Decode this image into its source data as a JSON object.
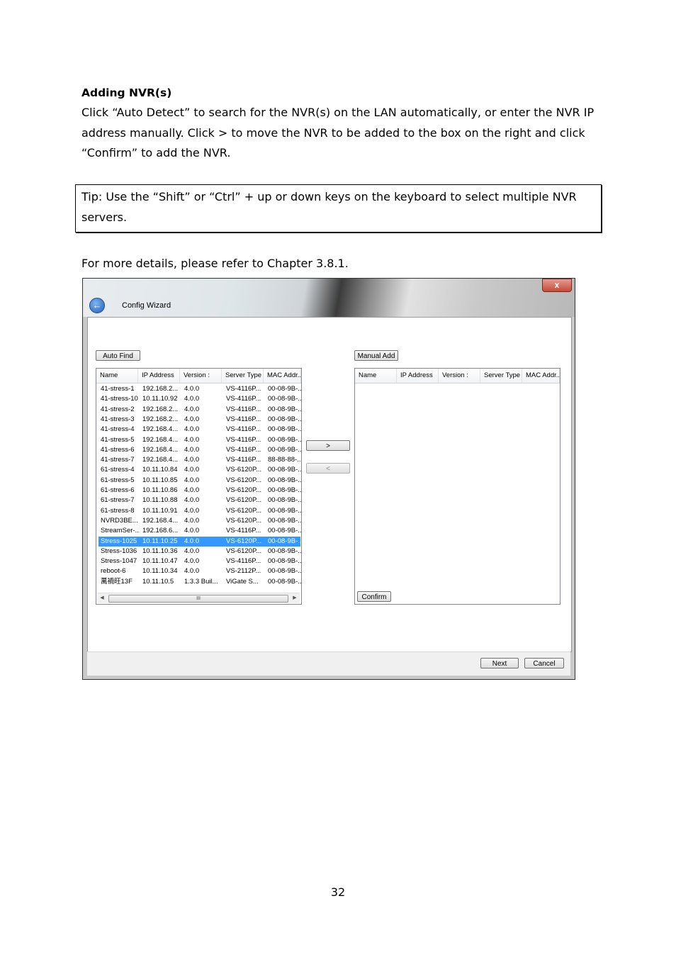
{
  "doc": {
    "heading": "Adding NVR(s)",
    "paragraph1": "Click “Auto Detect” to search for the NVR(s) on the LAN automatically, or enter the NVR IP address manually. Click > to move the NVR to be added to the box on the right and click “Confirm” to add the NVR.",
    "tip": "Tip: Use the “Shift” or “Ctrl” + up or down keys on the keyboard to select multiple NVR servers.",
    "paragraph2": "For more details, please refer to Chapter 3.8.1.",
    "page_number": "32"
  },
  "window": {
    "title": "Config Wizard",
    "close_label": "x",
    "back_icon": "back-arrow-icon",
    "auto_find_label": "Auto Find",
    "manual_add_label": "Manual Add",
    "move_right_label": ">",
    "move_left_label": "<",
    "confirm_label": "Confirm",
    "next_label": "Next",
    "cancel_label": "Cancel",
    "columns": [
      "Name",
      "IP Address",
      "Version :",
      "Server Type",
      "MAC Addr.."
    ],
    "rows": [
      [
        "41-stress-1",
        "192.168.2...",
        "4.0.0",
        "VS-4116P...",
        "00-08-9B-..."
      ],
      [
        "41-stress-10",
        "10.11.10.92",
        "4.0.0",
        "VS-4116P...",
        "00-08-9B-..."
      ],
      [
        "41-stress-2",
        "192.168.2...",
        "4.0.0",
        "VS-4116P...",
        "00-08-9B-..."
      ],
      [
        "41-stress-3",
        "192.168.2...",
        "4.0.0",
        "VS-4116P...",
        "00-08-9B-..."
      ],
      [
        "41-stress-4",
        "192.168.4...",
        "4.0.0",
        "VS-4116P...",
        "00-08-9B-..."
      ],
      [
        "41-stress-5",
        "192.168.4...",
        "4.0.0",
        "VS-4116P...",
        "00-08-9B-..."
      ],
      [
        "41-stress-6",
        "192.168.4...",
        "4.0.0",
        "VS-4116P...",
        "00-08-9B-..."
      ],
      [
        "41-stress-7",
        "192.168.4...",
        "4.0.0",
        "VS-4116P...",
        "88-88-88-..."
      ],
      [
        "61-stress-4",
        "10.11.10.84",
        "4.0.0",
        "VS-6120P...",
        "00-08-9B-..."
      ],
      [
        "61-stress-5",
        "10.11.10.85",
        "4.0.0",
        "VS-6120P...",
        "00-08-9B-..."
      ],
      [
        "61-stress-6",
        "10.11.10.86",
        "4.0.0",
        "VS-6120P...",
        "00-08-9B-..."
      ],
      [
        "61-stress-7",
        "10.11.10.88",
        "4.0.0",
        "VS-6120P...",
        "00-08-9B-..."
      ],
      [
        "61-stress-8",
        "10.11.10.91",
        "4.0.0",
        "VS-6120P...",
        "00-08-9B-..."
      ],
      [
        "NVRD3BE...",
        "192.168.4...",
        "4.0.0",
        "VS-6120P...",
        "00-08-9B-..."
      ],
      [
        "StreamSer-...",
        "192.168.6...",
        "4.0.0",
        "VS-4116P...",
        "00-08-9B-..."
      ],
      [
        "Stress-1025",
        "10.11.10.25",
        "4.0.0",
        "VS-6120P...",
        "00-08-9B-..."
      ],
      [
        "Stress-1036",
        "10.11.10.36",
        "4.0.0",
        "VS-6120P...",
        "00-08-9B-..."
      ],
      [
        "Stress-1047",
        "10.11.10.47",
        "4.0.0",
        "VS-4116P...",
        "00-08-9B-..."
      ],
      [
        "reboot-6",
        "10.11.10.34",
        "4.0.0",
        "VS-2112P...",
        "00-08-9B-..."
      ],
      [
        "萬禍旺13F",
        "10.11.10.5",
        "1.3.3 Buil...",
        "ViGate S...",
        "00-08-9B-..."
      ]
    ],
    "selected_row": "Stress-1025",
    "scrollbar_thumb": "III",
    "selection_color": "#3399ff"
  }
}
